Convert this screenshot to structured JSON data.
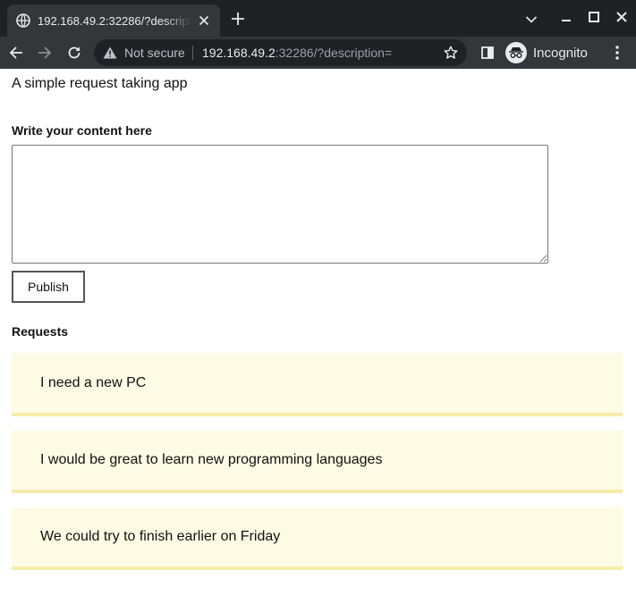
{
  "browser": {
    "tab_title": "192.168.49.2:32286/?description=",
    "security_label": "Not secure",
    "url_host": "192.168.49.2",
    "url_rest": ":32286/?description=",
    "profile_label": "Incognito"
  },
  "page": {
    "subtitle": "A simple request taking app",
    "form_label": "Write your content here",
    "content_value": "",
    "publish_label": "Publish",
    "requests_heading": "Requests",
    "requests": [
      "I need a new PC",
      "I would be great to learn new programming languages",
      "We could try to finish earlier on Friday"
    ]
  },
  "colors": {
    "chrome_dark": "#202124",
    "chrome_tab": "#35363a",
    "card_background": "#fefbe4",
    "card_border": "#f6ecaa"
  }
}
